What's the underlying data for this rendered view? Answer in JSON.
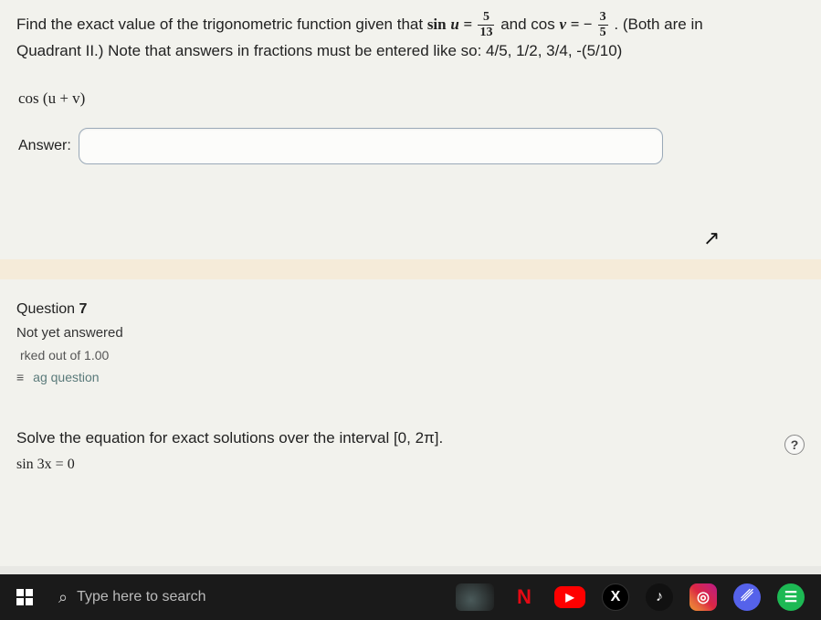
{
  "problem": {
    "text_a": "Find the exact value of the trigonometric function given that ",
    "sin_label": "sin",
    "u_var": "u",
    "equals": " = ",
    "frac1_num": "5",
    "frac1_den": "13",
    "between": " and cos ",
    "v_var": "v",
    "minus": " = − ",
    "frac2_num": "3",
    "frac2_den": "5",
    "after": ". (Both are in",
    "line2": "Quadrant II.) Note that answers in fractions must be entered like so: 4/5, 1/2, 3/4, -(5/10)"
  },
  "expression": "cos (u + v)",
  "answer_label": "Answer:",
  "answer_value": "",
  "question7": {
    "label_prefix": "Question ",
    "number": "7",
    "status": "Not yet answered",
    "marked": "rked out of 1.00",
    "flag": "ag question"
  },
  "q7body": {
    "line1": "Solve the equation for exact solutions over the interval [0, 2π].",
    "line2": "sin 3x = 0"
  },
  "help": "?",
  "taskbar": {
    "search_placeholder": "Type here to search"
  },
  "icons": {
    "n": "N",
    "yt": "▶",
    "x": "X",
    "tk": "♪",
    "ig": "◎",
    "dc": "␥",
    "sp": "☰",
    "flag": "≡"
  }
}
